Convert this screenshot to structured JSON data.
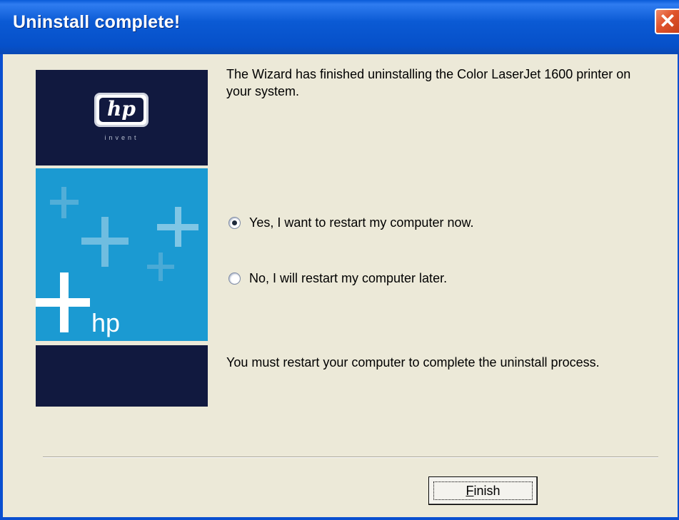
{
  "window": {
    "title": "Uninstall complete!",
    "close_glyph": "✕"
  },
  "banner": {
    "logo_text": "hp",
    "tagline": "invent",
    "brand_word": "hp"
  },
  "content": {
    "message_top": "The Wizard has finished uninstalling the Color LaserJet 1600 printer on your system.",
    "options": [
      {
        "label": "Yes, I want to restart my computer now.",
        "selected": true
      },
      {
        "label": "No, I will restart my computer later.",
        "selected": false
      }
    ],
    "message_bottom": "You must restart your computer to complete the uninstall process."
  },
  "buttons": {
    "finish_mnemonic": "F",
    "finish_rest": "inish"
  },
  "colors": {
    "titlebar": "#0a5bd8",
    "banner_dark": "#11193f",
    "banner_blue": "#1b9ad2",
    "dialog_bg": "#ece9d8"
  }
}
